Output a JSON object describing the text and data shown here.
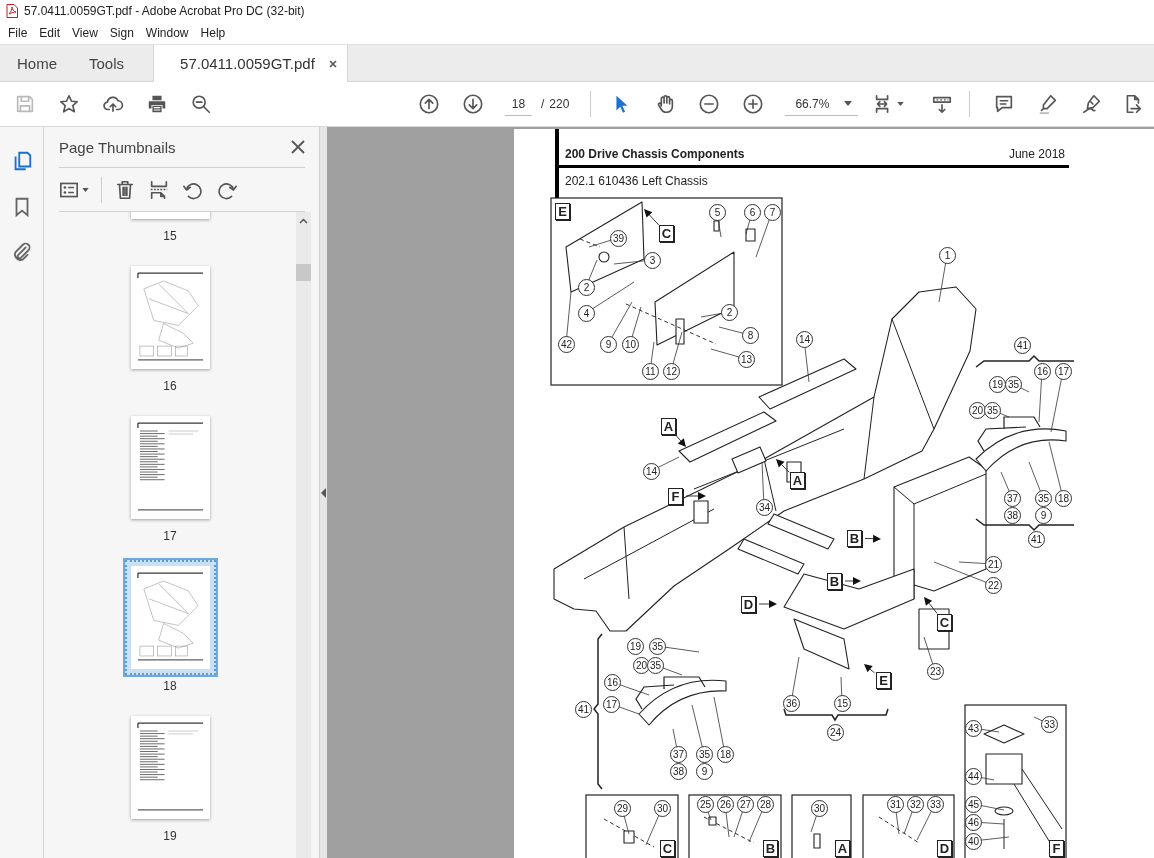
{
  "window": {
    "title": "57.0411.0059GT.pdf - Adobe Acrobat Pro DC (32-bit)"
  },
  "menu": [
    "File",
    "Edit",
    "View",
    "Sign",
    "Window",
    "Help"
  ],
  "tabs": [
    {
      "label": "Home",
      "kind": "nav",
      "selected": false
    },
    {
      "label": "Tools",
      "kind": "nav",
      "selected": false
    },
    {
      "label": "57.0411.0059GT.pdf",
      "kind": "document",
      "selected": true
    }
  ],
  "toolbar": {
    "page_number": "18",
    "page_separator": "/",
    "page_count": "220",
    "zoom": "66.7%"
  },
  "nav_rail": [
    {
      "kind": "pages",
      "selected": true
    },
    {
      "kind": "bookmarks",
      "selected": false
    },
    {
      "kind": "attachments",
      "selected": false
    }
  ],
  "sidebar": {
    "title": "Page Thumbnails",
    "thumbnails": [
      {
        "label": "15",
        "kind": "figure",
        "selected": false
      },
      {
        "label": "16",
        "kind": "figure",
        "selected": false
      },
      {
        "label": "17",
        "kind": "list",
        "selected": false
      },
      {
        "label": "18",
        "kind": "figure",
        "selected": true
      },
      {
        "label": "19",
        "kind": "list",
        "selected": false
      }
    ]
  },
  "page": {
    "section": "200 Drive Chassis Components",
    "date": "June 2018",
    "subtitle": "202.1 610436 Left Chassis",
    "callouts": [
      "5",
      "6",
      "7",
      "39",
      "3",
      "2",
      "4",
      "2",
      "8",
      "42",
      "9",
      "10",
      "13",
      "11",
      "12",
      "1",
      "14",
      "41",
      "16",
      "17",
      "19",
      "35",
      "20",
      "35",
      "14",
      "34",
      "37",
      "38",
      "35",
      "9",
      "18",
      "41",
      "21",
      "22",
      "23",
      "36",
      "15",
      "24",
      "19",
      "35",
      "20",
      "35",
      "16",
      "17",
      "41",
      "37",
      "38",
      "35",
      "9",
      "18",
      "33",
      "43",
      "44",
      "45",
      "46",
      "40",
      "29",
      "30",
      "25",
      "26",
      "27",
      "28",
      "30",
      "31",
      "32",
      "33"
    ],
    "view_labels": [
      "E",
      "C",
      "A",
      "A",
      "F",
      "B",
      "B",
      "D",
      "C",
      "E",
      "C",
      "B",
      "A",
      "D",
      "F"
    ]
  }
}
